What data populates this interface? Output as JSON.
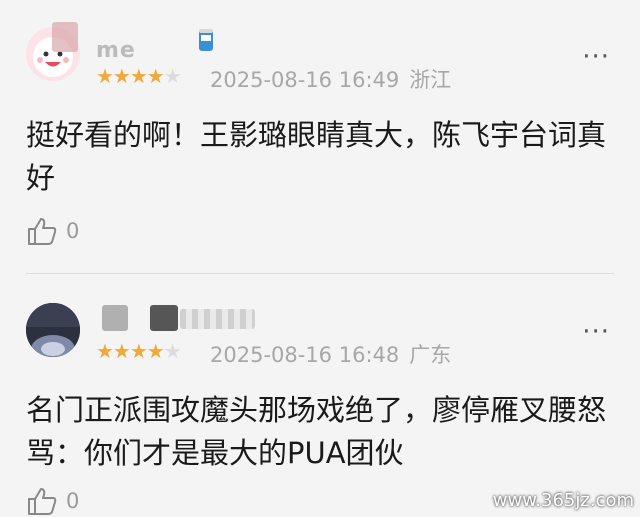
{
  "comments": [
    {
      "username": "me",
      "rating": 4,
      "stars_on": "★★★★",
      "stars_off": "★",
      "date": "2025-08-16 16:49",
      "location": "浙江",
      "text": "挺好看的啊！王影璐眼睛真大，陈飞宇台词真好",
      "likes": "0",
      "more_icon": "···"
    },
    {
      "username": "",
      "rating": 4,
      "stars_on": "★★★★",
      "stars_off": "★",
      "date": "2025-08-16 16:48",
      "location": "广东",
      "text": "名门正派围攻魔头那场戏绝了，廖停雁叉腰怒骂：你们才是最大的PUA团伙",
      "likes": "0",
      "more_icon": "···"
    }
  ],
  "watermark": "www.365jz.com",
  "colors": {
    "star": "#f2a93b",
    "star_empty": "#dcdcdc",
    "meta": "#a7a7a7",
    "background": "#f4f4f4"
  }
}
